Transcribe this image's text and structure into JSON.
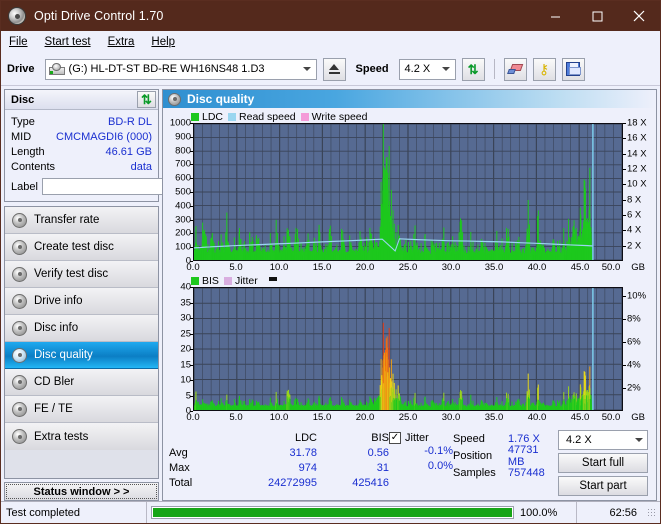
{
  "window": {
    "title": "Opti Drive Control 1.70",
    "icon": "disc-icon",
    "minimize": "minimize",
    "maximize": "maximize",
    "close": "close"
  },
  "menu": [
    "File",
    "Start test",
    "Extra",
    "Help"
  ],
  "toolbar": {
    "drive_label": "Drive",
    "drive_value": "(G:)  HL-DT-ST BD-RE  WH16NS48 1.D3",
    "eject_label": "eject",
    "speed_label": "Speed",
    "speed_value": "4.2 X",
    "refresh_icon": "refresh-icon",
    "erase_icon": "eraser-icon",
    "tools_icon": "keys-icon",
    "save_icon": "save-icon"
  },
  "disc": {
    "header": "Disc",
    "refresh_icon": "refresh-icon",
    "rows": [
      {
        "key": "Type",
        "value": "BD-R DL"
      },
      {
        "key": "MID",
        "value": "CMCMAGDI6 (000)"
      },
      {
        "key": "Length",
        "value": "46.61 GB"
      },
      {
        "key": "Contents",
        "value": "data"
      }
    ],
    "label_key": "Label",
    "label_value": "",
    "label_button_icon": "disc-icon"
  },
  "nav": [
    {
      "label": "Transfer rate",
      "active": false
    },
    {
      "label": "Create test disc",
      "active": false
    },
    {
      "label": "Verify test disc",
      "active": false
    },
    {
      "label": "Drive info",
      "active": false
    },
    {
      "label": "Disc info",
      "active": false
    },
    {
      "label": "Disc quality",
      "active": true
    },
    {
      "label": "CD Bler",
      "active": false
    },
    {
      "label": "FE / TE",
      "active": false
    },
    {
      "label": "Extra tests",
      "active": false
    }
  ],
  "status_window_button": "Status window > >",
  "main": {
    "title": "Disc quality",
    "icon": "disc-icon"
  },
  "stats": {
    "col_headers": [
      "",
      "LDC",
      "BIS"
    ],
    "rows": [
      {
        "label": "Avg",
        "ldc": "31.78",
        "bis": "0.56"
      },
      {
        "label": "Max",
        "ldc": "974",
        "bis": "31"
      },
      {
        "label": "Total",
        "ldc": "24272995",
        "bis": "425416"
      }
    ],
    "jitter_label": "Jitter",
    "jitter_checked": true,
    "jitter_avg": "-0.1%",
    "jitter_max": "0.0%",
    "speed_key": "Speed",
    "speed_value": "1.76 X",
    "position_key": "Position",
    "position_value": "47731 MB",
    "samples_key": "Samples",
    "samples_value": "757448",
    "speed_select": "4.2 X",
    "start_full": "Start full",
    "start_part": "Start part"
  },
  "statusbar": {
    "message": "Test completed",
    "progress_percent": "100.0%",
    "progress_value": 100,
    "elapsed": "62:56"
  },
  "colors": {
    "titlebar": "#54291c",
    "plot_bg": "#566a92",
    "ldc": "#1ec81e",
    "read_speed": "#9ad6f0",
    "write_speed": "#f49ad8",
    "bis": "#1ec81e",
    "jitter": "#d9aee0",
    "accent": "#1a2fd0",
    "progress": "#16a516",
    "marker": "#7fd4f2"
  },
  "chart_data": [
    {
      "type": "area",
      "name": "ldc-chart",
      "title": "",
      "xlabel": "GB",
      "ylabel": "",
      "xlim": [
        0,
        50
      ],
      "ylim": [
        0,
        1000
      ],
      "y2lim": [
        0,
        18
      ],
      "xticks": [
        "0.0",
        "5.0",
        "10.0",
        "15.0",
        "20.0",
        "25.0",
        "30.0",
        "35.0",
        "40.0",
        "45.0",
        "50.0"
      ],
      "xunit": "GB",
      "yticks": [
        0,
        100,
        200,
        300,
        400,
        500,
        600,
        700,
        800,
        900,
        1000
      ],
      "y2ticks": [
        "2 X",
        "4 X",
        "6 X",
        "8 X",
        "10 X",
        "12 X",
        "14 X",
        "16 X",
        "18 X"
      ],
      "grid": true,
      "legend": [
        {
          "label": "LDC",
          "color": "#1ec81e"
        },
        {
          "label": "Read speed",
          "color": "#9ad6f0"
        },
        {
          "label": "Write speed",
          "color": "#f49ad8"
        }
      ],
      "marker_x": 46.6,
      "series": [
        {
          "name": "LDC",
          "color": "#1ec81e",
          "x": [
            0.0,
            0.3,
            0.6,
            0.9,
            1.2,
            1.5,
            1.8,
            2.1,
            2.4,
            2.7,
            3.0,
            3.3,
            3.6,
            3.9,
            4.2,
            4.5,
            4.8,
            5.1,
            5.4,
            5.7,
            6.0,
            6.3,
            6.6,
            6.9,
            7.2,
            7.5,
            7.8,
            8.1,
            8.4,
            8.7,
            9.0,
            9.3,
            9.6,
            9.9,
            10.2,
            10.5,
            10.8,
            11.1,
            11.4,
            11.7,
            12.0,
            12.3,
            12.6,
            12.9,
            13.2,
            13.5,
            13.8,
            14.1,
            14.4,
            14.7,
            15.0,
            15.3,
            15.6,
            15.9,
            16.2,
            16.5,
            16.8,
            17.1,
            17.4,
            17.7,
            18.0,
            18.3,
            18.6,
            18.9,
            19.2,
            19.5,
            19.8,
            20.1,
            20.4,
            20.7,
            21.0,
            21.3,
            21.6,
            21.9,
            22.2,
            22.5,
            22.8,
            23.1,
            23.4,
            23.7,
            24.0,
            24.3,
            24.6,
            24.9,
            25.2,
            25.5,
            25.8,
            26.1,
            26.4,
            26.7,
            27.0,
            27.3,
            27.6,
            27.9,
            28.2,
            28.5,
            28.8,
            29.1,
            29.4,
            29.7,
            30.0,
            30.3,
            30.6,
            30.9,
            31.2,
            31.5,
            31.8,
            32.1,
            32.4,
            32.7,
            33.0,
            33.3,
            33.6,
            33.9,
            34.2,
            34.5,
            34.8,
            35.1,
            35.4,
            35.7,
            36.0,
            36.3,
            36.6,
            36.9,
            37.2,
            37.5,
            37.8,
            38.1,
            38.4,
            38.7,
            39.0,
            39.3,
            39.6,
            39.9,
            40.2,
            40.5,
            40.8,
            41.1,
            41.4,
            41.7,
            42.0,
            42.3,
            42.6,
            42.9,
            43.2,
            43.5,
            43.8,
            44.1,
            44.4,
            44.7,
            45.0,
            45.3,
            45.6,
            45.9,
            46.2,
            46.5
          ],
          "y": [
            60,
            200,
            80,
            120,
            300,
            70,
            90,
            250,
            60,
            110,
            80,
            160,
            60,
            280,
            90,
            70,
            130,
            60,
            200,
            80,
            100,
            60,
            170,
            90,
            60,
            240,
            70,
            110,
            60,
            90,
            150,
            60,
            200,
            70,
            60,
            120,
            90,
            330,
            60,
            80,
            190,
            60,
            100,
            60,
            170,
            80,
            60,
            120,
            60,
            220,
            70,
            90,
            60,
            180,
            60,
            110,
            60,
            90,
            240,
            60,
            70,
            150,
            60,
            100,
            60,
            190,
            70,
            120,
            60,
            260,
            90,
            160,
            110,
            430,
            820,
            974,
            560,
            310,
            180,
            120,
            230,
            90,
            140,
            60,
            120,
            60,
            180,
            70,
            100,
            60,
            130,
            90,
            60,
            170,
            60,
            110,
            60,
            200,
            70,
            90,
            60,
            140,
            60,
            110,
            230,
            70,
            90,
            60,
            160,
            60,
            100,
            60,
            190,
            70,
            120,
            60,
            90,
            60,
            150,
            60,
            110,
            60,
            200,
            70,
            90,
            60,
            170,
            60,
            120,
            60,
            330,
            90,
            110,
            60,
            260,
            70,
            140,
            60,
            100,
            60,
            190,
            60,
            120,
            70,
            160,
            60,
            230,
            90,
            400,
            120,
            330,
            170,
            420,
            280,
            520,
            60
          ]
        },
        {
          "name": "Read speed",
          "color": "#9ad6f0",
          "x": [
            0,
            2,
            4,
            6,
            8,
            10,
            12,
            14,
            16,
            18,
            20,
            22,
            23.5,
            24,
            26,
            28,
            30,
            32,
            34,
            36,
            38,
            40,
            42,
            44,
            46,
            46.6
          ],
          "y_speed": [
            1.6,
            1.75,
            1.85,
            1.95,
            2.05,
            2.15,
            2.25,
            2.35,
            2.45,
            2.55,
            2.65,
            2.75,
            1.2,
            2.8,
            2.7,
            2.62,
            2.55,
            2.5,
            2.45,
            2.4,
            2.3,
            2.2,
            2.1,
            2.0,
            1.9,
            1.85
          ]
        }
      ]
    },
    {
      "type": "area",
      "name": "bis-chart",
      "title": "",
      "xlabel": "GB",
      "xlim": [
        0,
        50
      ],
      "ylim": [
        0,
        40
      ],
      "y2lim": [
        0,
        10
      ],
      "xticks": [
        "0.0",
        "5.0",
        "10.0",
        "15.0",
        "20.0",
        "25.0",
        "30.0",
        "35.0",
        "40.0",
        "45.0",
        "50.0"
      ],
      "xunit": "GB",
      "yticks": [
        0,
        5,
        10,
        15,
        20,
        25,
        30,
        35,
        40
      ],
      "y2ticks": [
        "2%",
        "4%",
        "6%",
        "8%",
        "10%"
      ],
      "grid": true,
      "legend": [
        {
          "label": "BIS",
          "color": "#1ec81e"
        },
        {
          "label": "Jitter",
          "color": "#d9aee0"
        }
      ],
      "marker_x": 46.6,
      "series": [
        {
          "name": "BIS",
          "color": "#1ec81e",
          "x": [
            0.0,
            0.3,
            0.6,
            0.9,
            1.2,
            1.5,
            1.8,
            2.1,
            2.4,
            2.7,
            3.0,
            3.3,
            3.6,
            3.9,
            4.2,
            4.5,
            4.8,
            5.1,
            5.4,
            5.7,
            6.0,
            6.3,
            6.6,
            6.9,
            7.2,
            7.5,
            7.8,
            8.1,
            8.4,
            8.7,
            9.0,
            9.3,
            9.6,
            9.9,
            10.2,
            10.5,
            10.8,
            11.1,
            11.4,
            11.7,
            12.0,
            12.3,
            12.6,
            12.9,
            13.2,
            13.5,
            13.8,
            14.1,
            14.4,
            14.7,
            15.0,
            15.3,
            15.6,
            15.9,
            16.2,
            16.5,
            16.8,
            17.1,
            17.4,
            17.7,
            18.0,
            18.3,
            18.6,
            18.9,
            19.2,
            19.5,
            19.8,
            20.1,
            20.4,
            20.7,
            21.0,
            21.3,
            21.6,
            21.9,
            22.2,
            22.5,
            22.8,
            23.1,
            23.4,
            23.7,
            24.0,
            24.3,
            24.6,
            24.9,
            25.2,
            25.5,
            25.8,
            26.1,
            26.4,
            26.7,
            27.0,
            27.3,
            27.6,
            27.9,
            28.2,
            28.5,
            28.8,
            29.1,
            29.4,
            29.7,
            30.0,
            30.3,
            30.6,
            30.9,
            31.2,
            31.5,
            31.8,
            32.1,
            32.4,
            32.7,
            33.0,
            33.3,
            33.6,
            33.9,
            34.2,
            34.5,
            34.8,
            35.1,
            35.4,
            35.7,
            36.0,
            36.3,
            36.6,
            36.9,
            37.2,
            37.5,
            37.8,
            38.1,
            38.4,
            38.7,
            39.0,
            39.3,
            39.6,
            39.9,
            40.2,
            40.5,
            40.8,
            41.1,
            41.4,
            41.7,
            42.0,
            42.3,
            42.6,
            42.9,
            43.2,
            43.5,
            43.8,
            44.1,
            44.4,
            44.7,
            45.0,
            45.3,
            45.6,
            45.9,
            46.2,
            46.5
          ],
          "y": [
            1,
            5,
            2,
            2,
            3,
            1,
            2,
            4,
            1,
            2,
            2,
            3,
            1,
            4,
            2,
            1,
            3,
            1,
            4,
            2,
            2,
            1,
            3,
            2,
            1,
            4,
            1,
            2,
            1,
            2,
            3,
            1,
            4,
            1,
            1,
            2,
            2,
            10,
            1,
            2,
            3,
            1,
            2,
            1,
            3,
            2,
            1,
            2,
            1,
            4,
            1,
            2,
            1,
            3,
            1,
            2,
            1,
            2,
            4,
            1,
            1,
            3,
            1,
            2,
            1,
            3,
            1,
            2,
            1,
            5,
            2,
            4,
            6,
            12,
            22,
            31,
            18,
            10,
            6,
            4,
            7,
            2,
            3,
            1,
            3,
            1,
            4,
            1,
            2,
            1,
            3,
            2,
            1,
            4,
            1,
            2,
            1,
            5,
            1,
            2,
            1,
            3,
            1,
            2,
            5,
            1,
            2,
            1,
            4,
            1,
            2,
            1,
            4,
            1,
            3,
            1,
            2,
            1,
            3,
            1,
            2,
            1,
            5,
            1,
            2,
            1,
            4,
            1,
            3,
            1,
            9,
            2,
            3,
            1,
            6,
            1,
            3,
            1,
            2,
            1,
            4,
            1,
            3,
            1,
            4,
            1,
            6,
            2,
            8,
            3,
            7,
            4,
            9,
            6,
            11,
            1
          ]
        },
        {
          "name": "Jitter",
          "color": "#d9aee0",
          "x": [
            0,
            10,
            20,
            30,
            40,
            46.6
          ],
          "y_pct": [
            0,
            0,
            0,
            0,
            0,
            0
          ]
        }
      ]
    }
  ]
}
